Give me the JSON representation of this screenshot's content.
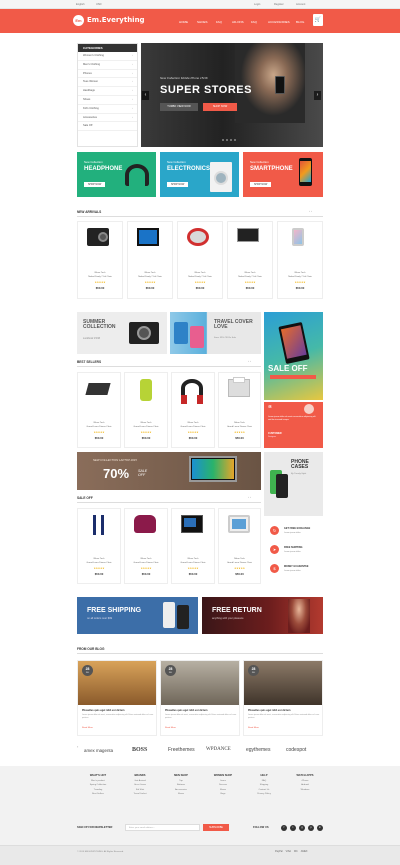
{
  "topbar": {
    "language": "English",
    "currency": "USD",
    "login": "Login",
    "register": "Register",
    "account": "Account"
  },
  "header": {
    "logo_mark": "Em",
    "logo_text": "Em.Everything",
    "nav": [
      "HOME",
      "SHOES",
      "FAQ",
      "AD-ONS",
      "FAQ",
      "ACCESSORIES",
      "BLOG"
    ],
    "cart_icon": "cart-icon",
    "accent": "#f15a48"
  },
  "categories": {
    "title": "CATEGORIES",
    "items": [
      "Women's Clothing",
      "Men's Clothing",
      "Phones",
      "Tees Women",
      "Handbags",
      "Shoes",
      "Kid's Clothing",
      "Accessories",
      "Sale Off"
    ]
  },
  "hero": {
    "subtitle": "New Collection Mobile Phone 15/16",
    "title": "SUPER STORES",
    "btn_primary": "TURBO VIEW NOW",
    "btn_secondary": "SHOP NOW"
  },
  "promos": [
    {
      "small": "New Collection",
      "title": "HEADPHONE",
      "btn": "SHOP NOW",
      "color": "#22b07d"
    },
    {
      "small": "New Collection",
      "title": "ELECTRONICS",
      "btn": "SHOP NOW",
      "color": "#2aa6c9"
    },
    {
      "small": "New Collection",
      "title": "SMARTPHONE",
      "btn": "SHOP NOW",
      "color": "#f15a48"
    }
  ],
  "new_arrivals": {
    "title": "NEW ARRIVALS",
    "products": [
      {
        "cat": "Nikon Tech",
        "name": "Naked Dealy 7 Jal Chair",
        "price": "$50.00"
      },
      {
        "cat": "Nikon Tech",
        "name": "Naked Dealy 7 Jal Chair",
        "price": "$50.00"
      },
      {
        "cat": "Nikon Tech",
        "name": "Naked Dealy 7 Jal Chair",
        "price": "$50.00"
      },
      {
        "cat": "Nikon Tech",
        "name": "Naked Dealy 7 Jal Chair",
        "price": "$50.00"
      },
      {
        "cat": "Nikon Tech",
        "name": "Naked Dealy 7 Jal Chair",
        "price": "$50.00"
      }
    ]
  },
  "banners": {
    "summer_title": "SUMMER COLLECTION",
    "summer_sub": "Lookbook 15/16",
    "travel_title": "TRAVEL COVER LOVE",
    "travel_sub": "Save 10% Off On Sale",
    "sale_off": "SALE OFF",
    "laptop_sub": "NEW COLLECTION LAPTOP 2015",
    "laptop_pct": "70%",
    "laptop_sale": "SALE OFF",
    "phone_title": "PHONE CASES",
    "phone_sub": "By Trendy Style"
  },
  "best_sellers": {
    "title": "BEST SELLERS",
    "products": [
      {
        "cat": "Nikon Tech",
        "name": "Grand Luxur Dinner Chair",
        "price": "$50.00"
      },
      {
        "cat": "Nikon Tech",
        "name": "Grand Luxur Dinner Chair",
        "price": "$50.00"
      },
      {
        "cat": "Nikon Tech",
        "name": "Grand Luxur Dinner Chair",
        "price": "$50.00"
      },
      {
        "cat": "Nikon Tech",
        "name": "Grand Luxur Dinner Chair",
        "price": "$50.00"
      }
    ]
  },
  "testimonial": {
    "text": "Lorem ipsum dolor sit amet consectetur adipiscing elit sed do eiusmod tempor",
    "name": "CUSTOMER",
    "role": "Designer"
  },
  "sale_off": {
    "title": "SALE OFF",
    "products": [
      {
        "cat": "Nikon Tech",
        "name": "Grand Luxur Dinner Chair",
        "price": "$50.00"
      },
      {
        "cat": "Nikon Tech",
        "name": "Grand Luxur Dinner Chair",
        "price": "$50.00"
      },
      {
        "cat": "Nikon Tech",
        "name": "Grand Luxur Dinner Chair",
        "price": "$50.00"
      },
      {
        "cat": "Nikon Tech",
        "name": "Grand Luxur Dinner Chair",
        "price": "$50.00"
      }
    ]
  },
  "services": [
    {
      "title": "GET FREE EXCHANGE",
      "sub": "Lorem ipsum dolor"
    },
    {
      "title": "FREE SHIPPING",
      "sub": "Lorem ipsum dolor"
    },
    {
      "title": "MONEY GUARANTEE",
      "sub": "Lorem ipsum dolor"
    }
  ],
  "shipping": {
    "free_shipping": "FREE SHIPPING",
    "free_shipping_sub": "on all orders over $99",
    "free_return": "FREE RETURN",
    "free_return_sub": "anything with your pleasure"
  },
  "blog": {
    "title": "FROM OUR BLOG",
    "posts": [
      {
        "day": "28",
        "month": "JUL",
        "title": "Phasellus quis eget nibh est dictum",
        "text": "Lorem ipsum dolor sit amet, consectetur adipiscing elit. Etiam euismod dolor vel nunc pretium.",
        "more": "Read More"
      },
      {
        "day": "28",
        "month": "JUL",
        "title": "Phasellus quis eget nibh est dictum",
        "text": "Lorem ipsum dolor sit amet, consectetur adipiscing elit. Etiam euismod dolor vel nunc pretium.",
        "more": "Read More"
      },
      {
        "day": "28",
        "month": "JUL",
        "title": "Phasellus quis eget nibh est dictum",
        "text": "Lorem ipsum dolor sit amet, consectetur adipiscing elit. Etiam euismod dolor vel nunc pretium.",
        "more": "Read More"
      }
    ]
  },
  "brands": [
    "amex magenta",
    "BOSS",
    "Freethemes",
    "WPDANCE",
    "egythemes",
    "codespot"
  ],
  "footer": {
    "columns": [
      {
        "title": "WHAT'S HOT",
        "items": [
          "Men's product",
          "Spring Collection",
          "Trending",
          "Best Sellers"
        ]
      },
      {
        "title": "BRANDS",
        "items": [
          "Just Arrived",
          "Gucci Jeans",
          "Kid Shirt",
          "Travel Jacket"
        ]
      },
      {
        "title": "MEN SHOP",
        "items": [
          "Top",
          "Bottoms",
          "Accessories",
          "Shoes"
        ]
      },
      {
        "title": "WOMEN SHOP",
        "items": [
          "Jeans",
          "Dresses",
          "Shoes",
          "Bags"
        ]
      },
      {
        "title": "HELP",
        "items": [
          "FAQ",
          "Shipping",
          "Contact Us",
          "Privacy Policy"
        ]
      },
      {
        "title": "WATCH APPS",
        "items": [
          "iPhone",
          "Android",
          "Windows"
        ]
      }
    ],
    "newsletter_label": "SIGN UP FOR NEWSLETTER",
    "newsletter_placeholder": "Enter your email address...",
    "newsletter_btn": "SUBSCRIBE",
    "follow_label": "FOLLOW US",
    "social": [
      "f",
      "t",
      "g",
      "p",
      "in"
    ],
    "copyright": "© 2015 EM EVERYTHING. All Rights Reserved.",
    "payments": [
      "PayPal",
      "VISA",
      "MC",
      "AMEX"
    ]
  }
}
